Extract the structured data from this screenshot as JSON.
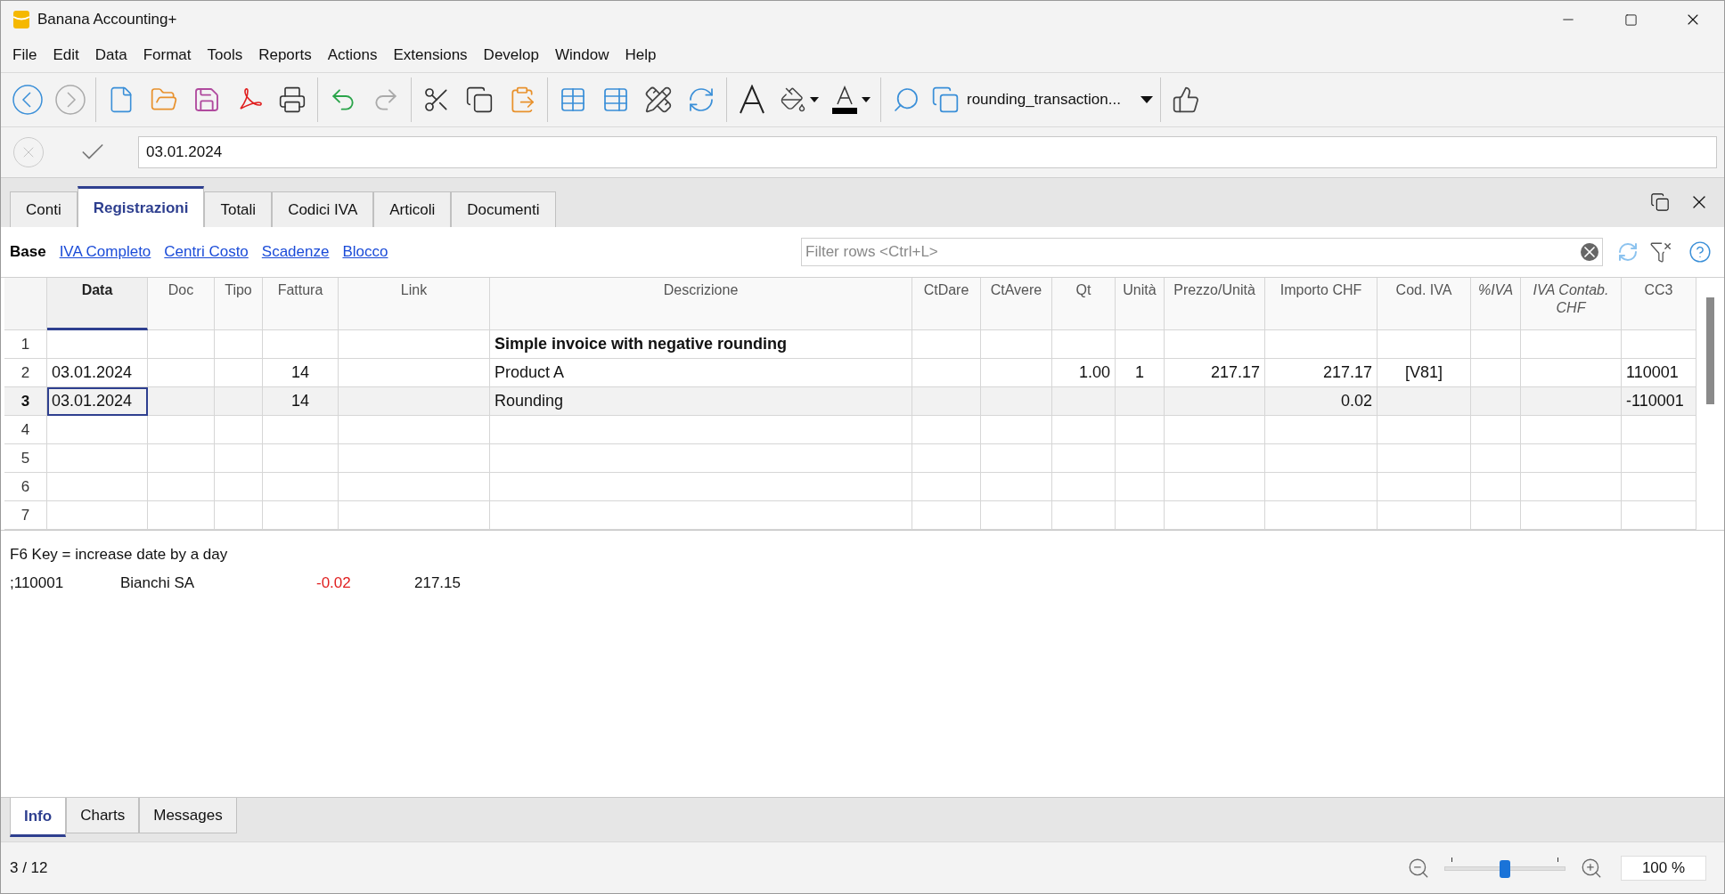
{
  "window": {
    "title": "Banana Accounting+"
  },
  "menu": [
    "File",
    "Edit",
    "Data",
    "Format",
    "Tools",
    "Reports",
    "Actions",
    "Extensions",
    "Develop",
    "Window",
    "Help"
  ],
  "toolbar": {
    "file_selector": "rounding_transaction..."
  },
  "edit_field": {
    "value": "03.01.2024"
  },
  "tabs": [
    {
      "label": "Conti",
      "selected": false
    },
    {
      "label": "Registrazioni",
      "selected": true
    },
    {
      "label": "Totali",
      "selected": false
    },
    {
      "label": "Codici IVA",
      "selected": false
    },
    {
      "label": "Articoli",
      "selected": false
    },
    {
      "label": "Documenti",
      "selected": false
    }
  ],
  "views": [
    {
      "label": "Base",
      "selected": true
    },
    {
      "label": "IVA Completo",
      "selected": false
    },
    {
      "label": "Centri Costo",
      "selected": false
    },
    {
      "label": "Scadenze",
      "selected": false
    },
    {
      "label": "Blocco",
      "selected": false
    }
  ],
  "filter": {
    "placeholder": "Filter rows <Ctrl+L>"
  },
  "table": {
    "columns": [
      {
        "label": "Data",
        "selected": true,
        "italic": false
      },
      {
        "label": "Doc",
        "selected": false,
        "italic": false
      },
      {
        "label": "Tipo",
        "selected": false,
        "italic": false
      },
      {
        "label": "Fattura",
        "selected": false,
        "italic": false
      },
      {
        "label": "Link",
        "selected": false,
        "italic": false
      },
      {
        "label": "Descrizione",
        "selected": false,
        "italic": false
      },
      {
        "label": "CtDare",
        "selected": false,
        "italic": false
      },
      {
        "label": "CtAvere",
        "selected": false,
        "italic": false
      },
      {
        "label": "Qt",
        "selected": false,
        "italic": false
      },
      {
        "label": "Unità",
        "selected": false,
        "italic": false
      },
      {
        "label": "Prezzo/Unità",
        "selected": false,
        "italic": false
      },
      {
        "label": "Importo CHF",
        "selected": false,
        "italic": false
      },
      {
        "label": "Cod. IVA",
        "selected": false,
        "italic": false
      },
      {
        "label": "%IVA",
        "selected": false,
        "italic": true
      },
      {
        "label": "IVA Contab. CHF",
        "selected": false,
        "italic": true
      },
      {
        "label": "CC3",
        "selected": false,
        "italic": false
      }
    ],
    "rows": [
      {
        "number": "1",
        "selected": false,
        "kind": "title",
        "cells": [
          null,
          null,
          null,
          null,
          null,
          "Simple invoice with negative rounding",
          null,
          null,
          null,
          null,
          null,
          null,
          null,
          null,
          null,
          null
        ]
      },
      {
        "number": "2",
        "selected": false,
        "kind": "entry",
        "cells": [
          "03.01.2024",
          null,
          null,
          "14",
          null,
          "Product A",
          null,
          null,
          "1.00",
          "1",
          "217.17",
          "217.17",
          "[V81]",
          null,
          null,
          "110001"
        ]
      },
      {
        "number": "3",
        "selected": true,
        "kind": "entry",
        "cells": [
          "03.01.2024",
          null,
          null,
          "14",
          null,
          "Rounding",
          null,
          null,
          null,
          null,
          null,
          "0.02",
          null,
          null,
          null,
          "-110001"
        ]
      },
      {
        "number": "4",
        "selected": false,
        "kind": "entry",
        "cells": [
          null,
          null,
          null,
          null,
          null,
          null,
          null,
          null,
          null,
          null,
          null,
          null,
          null,
          null,
          null,
          null
        ]
      },
      {
        "number": "5",
        "selected": false,
        "kind": "entry",
        "cells": [
          null,
          null,
          null,
          null,
          null,
          null,
          null,
          null,
          null,
          null,
          null,
          null,
          null,
          null,
          null,
          null
        ]
      },
      {
        "number": "6",
        "selected": false,
        "kind": "entry",
        "cells": [
          null,
          null,
          null,
          null,
          null,
          null,
          null,
          null,
          null,
          null,
          null,
          null,
          null,
          null,
          null,
          null
        ]
      },
      {
        "number": "7",
        "selected": false,
        "kind": "entry",
        "cells": [
          null,
          null,
          null,
          null,
          null,
          null,
          null,
          null,
          null,
          null,
          null,
          null,
          null,
          null,
          null,
          null
        ]
      }
    ]
  },
  "info": {
    "hint": "F6 Key = increase date by a day",
    "entries": [
      {
        "account": ";110001",
        "name": "Bianchi SA",
        "amount": "-0.02",
        "negative": true,
        "balance": "217.15"
      }
    ]
  },
  "bottom_tabs": [
    {
      "label": "Info",
      "selected": true
    },
    {
      "label": "Charts",
      "selected": false
    },
    {
      "label": "Messages",
      "selected": false
    }
  ],
  "status_bar": {
    "position": "3 / 12",
    "zoom": {
      "level": 0.5,
      "reading": "100 %"
    }
  }
}
